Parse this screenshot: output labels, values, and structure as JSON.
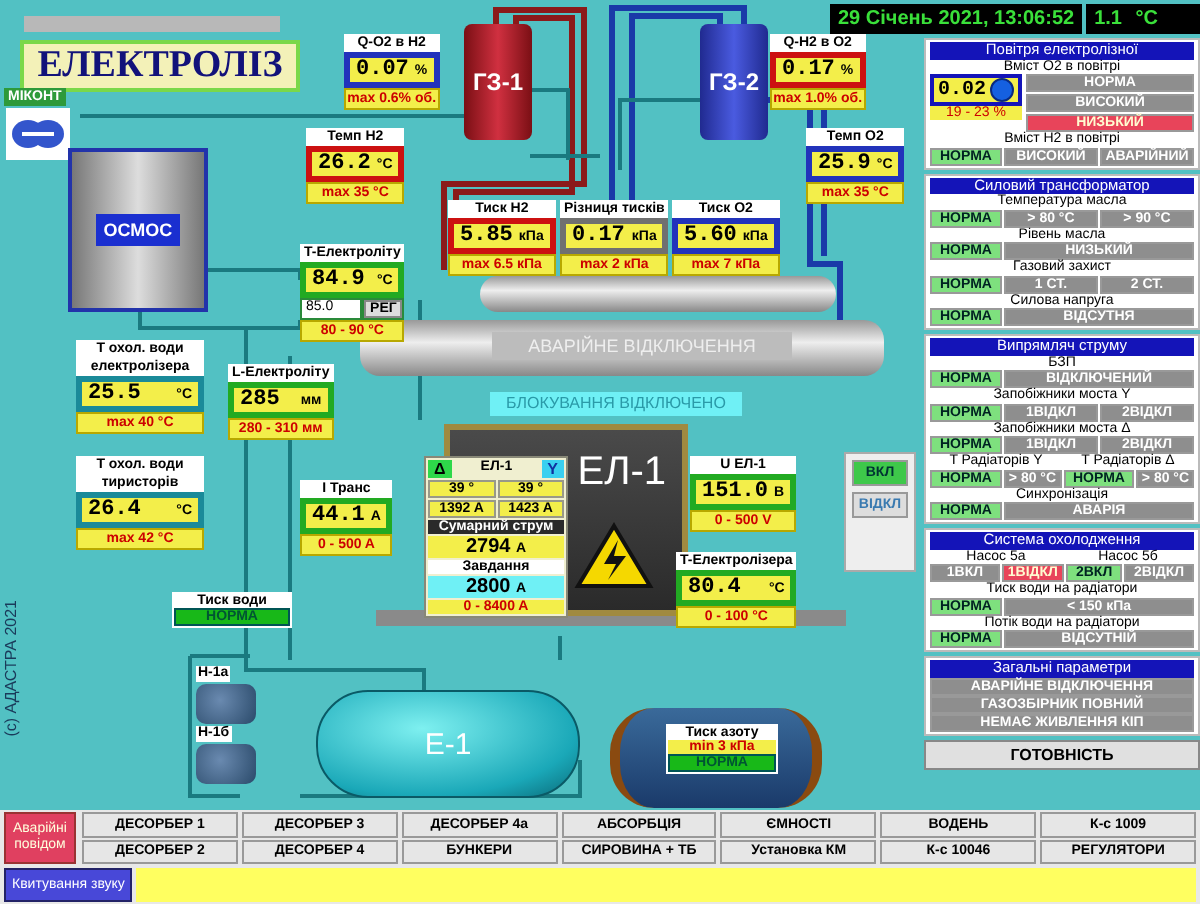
{
  "header": {
    "title": "ЕЛЕКТРОЛІЗ",
    "datetime": "29 Січень 2021, 13:06:52",
    "outdoor_temp": "1.1",
    "outdoor_unit": "°C"
  },
  "controller": {
    "label": "МІКОНТ"
  },
  "equipment": [
    {
      "kind": "h2-separator",
      "label": "ГЗ-1"
    },
    {
      "kind": "o2-separator",
      "label": "ГЗ-2"
    },
    {
      "kind": "osmosis",
      "label": "ОСМОС"
    },
    {
      "kind": "tank",
      "label": "Е-1"
    },
    {
      "kind": "pump-a",
      "label": "Н-1а"
    },
    {
      "kind": "pump-b",
      "label": "Н-1б"
    }
  ],
  "gauges": [
    {
      "title": "Q-O2 в H2",
      "value": "0.07",
      "unit": "%",
      "limit": "max 0.6% об.",
      "color": "#2233bb"
    },
    {
      "title": "Q-H2 в O2",
      "value": "0.17",
      "unit": "%",
      "limit": "max 1.0% об.",
      "color": "#cc1111"
    },
    {
      "title": "Темп H2",
      "value": "26.2",
      "unit": "°C",
      "limit": "max 35 °C",
      "color": "#cc1111"
    },
    {
      "title": "Темп O2",
      "value": "25.9",
      "unit": "°C",
      "limit": "max 35 °C",
      "color": "#2233bb"
    },
    {
      "title": "Тиск H2",
      "value": "5.85",
      "unit": "кПа",
      "limit": "max 6.5 кПа",
      "color": "#cc1111"
    },
    {
      "title": "Різниця тисків",
      "value": "0.17",
      "unit": "кПа",
      "limit": "max 2 кПа",
      "color": "#707070"
    },
    {
      "title": "Тиск O2",
      "value": "5.60",
      "unit": "кПа",
      "limit": "max 7 кПа",
      "color": "#2233bb"
    },
    {
      "title": "T-Електроліту",
      "value": "84.9",
      "unit": "°C",
      "limit": "80 - 90 °C",
      "color": "#22aa22",
      "setpoint": "85.0",
      "mode": "РЕГ"
    },
    {
      "title": "Т охол. води електролізера",
      "value": "25.5",
      "unit": "°C",
      "limit": "max 40 °C",
      "color": "#1a8a99"
    },
    {
      "title": "Т охол. води тиристорів",
      "value": "26.4",
      "unit": "°C",
      "limit": "max 42 °C",
      "color": "#1a8a99"
    },
    {
      "title": "L-Електроліту",
      "value": "285",
      "unit": "мм",
      "limit": "280 - 310 мм",
      "color": "#22aa22"
    },
    {
      "title": "I Транс",
      "value": "44.1",
      "unit": "A",
      "limit": "0 - 500 A",
      "color": "#22aa22"
    },
    {
      "title": "U ЕЛ-1",
      "value": "151.0",
      "unit": "В",
      "limit": "0 - 500 V",
      "color": "#22aa22"
    },
    {
      "title": "T-Електролізера",
      "value": "80.4",
      "unit": "°C",
      "limit": "0 - 100 °C",
      "color": "#22aa22"
    }
  ],
  "electrolyzer": {
    "label": "ЕЛ-1",
    "bridge_delta": "Δ",
    "name": "ЕЛ-1",
    "bridge_y": "Y",
    "temps": [
      {
        "value": "39",
        "unit": "°"
      },
      {
        "value": "39",
        "unit": "°"
      }
    ],
    "currents": [
      {
        "value": "1392",
        "unit": "A"
      },
      {
        "value": "1423",
        "unit": "A"
      }
    ],
    "total_title": "Сумарний струм",
    "total": "2794",
    "total_unit": "A",
    "setpoint_title": "Завдання",
    "setpoint": "2800",
    "setpoint_unit": "A",
    "range": "0 - 8400 A"
  },
  "emergency_banner": {
    "text": "АВАРІЙНЕ ВІДКЛЮЧЕННЯ",
    "active": false
  },
  "blocking_banner": {
    "text": "БЛОКУВАННЯ ВІДКЛЮЧЕНО",
    "active": true
  },
  "power_buttons": [
    {
      "label": "ВКЛ",
      "selected": true
    },
    {
      "label": "ВІДКЛ",
      "selected": false
    }
  ],
  "water_pressure": {
    "title": "Тиск води",
    "status": "НОРМА"
  },
  "nitrogen": {
    "title": "Тиск азоту",
    "limit": "min 3 кПа",
    "status": "НОРМА"
  },
  "copyright": "(c) АДАСТРА 2021",
  "panels": [
    {
      "title": "Повітря електролізної",
      "rows": [
        {
          "kind": "label",
          "texts": [
            "Вміст О2 в повітрі"
          ]
        },
        {
          "kind": "reading",
          "value": "0.02",
          "range": "19 - 23 %",
          "cells": [
            {
              "text": "НОРМА",
              "kind": "off"
            },
            {
              "text": "ВИСОКИЙ",
              "kind": "off"
            },
            {
              "text": "НИЗЬКИЙ",
              "kind": "alarm"
            }
          ]
        },
        {
          "kind": "label",
          "texts": [
            "Вміст H2 в повітрі"
          ]
        },
        {
          "kind": "status",
          "cells": [
            {
              "text": "НОРМА",
              "kind": "norm"
            },
            {
              "text": "ВИСОКИЙ",
              "kind": "off"
            },
            {
              "text": "АВАРІЙНИЙ",
              "kind": "off"
            }
          ]
        }
      ]
    },
    {
      "title": "Силовий трансформатор",
      "rows": [
        {
          "kind": "label",
          "texts": [
            "Температура масла"
          ]
        },
        {
          "kind": "status",
          "cells": [
            {
              "text": "НОРМА",
              "kind": "norm"
            },
            {
              "text": "> 80 °C",
              "kind": "off"
            },
            {
              "text": "> 90 °C",
              "kind": "off"
            }
          ]
        },
        {
          "kind": "label",
          "texts": [
            "Рівень масла"
          ]
        },
        {
          "kind": "status",
          "cells": [
            {
              "text": "НОРМА",
              "kind": "norm"
            },
            {
              "text": "НИЗЬКИЙ",
              "kind": "off"
            }
          ]
        },
        {
          "kind": "label",
          "texts": [
            "Газовий захист"
          ]
        },
        {
          "kind": "status",
          "cells": [
            {
              "text": "НОРМА",
              "kind": "norm"
            },
            {
              "text": "1 СТ.",
              "kind": "off"
            },
            {
              "text": "2 СТ.",
              "kind": "off"
            }
          ]
        },
        {
          "kind": "label",
          "texts": [
            "Силова напруга"
          ]
        },
        {
          "kind": "status",
          "cells": [
            {
              "text": "НОРМА",
              "kind": "norm"
            },
            {
              "text": "ВІДСУТНЯ",
              "kind": "off"
            }
          ]
        }
      ]
    },
    {
      "title": "Випрямляч струму",
      "rows": [
        {
          "kind": "label",
          "texts": [
            "БЗП"
          ]
        },
        {
          "kind": "status",
          "cells": [
            {
              "text": "НОРМА",
              "kind": "norm"
            },
            {
              "text": "ВІДКЛЮЧЕНИЙ",
              "kind": "off"
            }
          ]
        },
        {
          "kind": "label",
          "texts": [
            "Запобіжники моста Y"
          ]
        },
        {
          "kind": "status",
          "cells": [
            {
              "text": "НОРМА",
              "kind": "norm"
            },
            {
              "text": "1ВІДКЛ",
              "kind": "off"
            },
            {
              "text": "2ВІДКЛ",
              "kind": "off"
            }
          ]
        },
        {
          "kind": "label",
          "texts": [
            "Запобіжники моста Δ"
          ]
        },
        {
          "kind": "status",
          "cells": [
            {
              "text": "НОРМА",
              "kind": "norm"
            },
            {
              "text": "1ВІДКЛ",
              "kind": "off"
            },
            {
              "text": "2ВІДКЛ",
              "kind": "off"
            }
          ]
        },
        {
          "kind": "label",
          "texts": [
            "T Радіаторів Y",
            "T Радіаторів Δ"
          ]
        },
        {
          "kind": "status",
          "cells": [
            {
              "text": "НОРМА",
              "kind": "norm"
            },
            {
              "text": "> 80 °C",
              "kind": "off"
            },
            {
              "text": "НОРМА",
              "kind": "norm"
            },
            {
              "text": "> 80 °C",
              "kind": "off"
            }
          ]
        },
        {
          "kind": "label",
          "texts": [
            "Синхронізація"
          ]
        },
        {
          "kind": "status",
          "cells": [
            {
              "text": "НОРМА",
              "kind": "norm"
            },
            {
              "text": "АВАРІЯ",
              "kind": "off"
            }
          ]
        }
      ]
    },
    {
      "title": "Система охолодження",
      "rows": [
        {
          "kind": "label",
          "texts": [
            "Насос 5а",
            "Насос 5б"
          ]
        },
        {
          "kind": "status",
          "cells": [
            {
              "text": "1ВКЛ",
              "kind": "off"
            },
            {
              "text": "1ВІДКЛ",
              "kind": "alarm"
            },
            {
              "text": "2ВКЛ",
              "kind": "norm"
            },
            {
              "text": "2ВІДКЛ",
              "kind": "off"
            }
          ]
        },
        {
          "kind": "label",
          "texts": [
            "Тиск води на радіатори"
          ]
        },
        {
          "kind": "status",
          "cells": [
            {
              "text": "НОРМА",
              "kind": "norm"
            },
            {
              "text": "< 150 кПа",
              "kind": "off"
            }
          ]
        },
        {
          "kind": "label",
          "texts": [
            "Потік води на радіатори"
          ]
        },
        {
          "kind": "status",
          "cells": [
            {
              "text": "НОРМА",
              "kind": "norm"
            },
            {
              "text": "ВІДСУТНІЙ",
              "kind": "off"
            }
          ]
        }
      ]
    },
    {
      "title": "Загальні параметри",
      "rows": [
        {
          "kind": "status",
          "cells": [
            {
              "text": "АВАРІЙНЕ ВІДКЛЮЧЕННЯ",
              "kind": "off"
            }
          ]
        },
        {
          "kind": "status",
          "cells": [
            {
              "text": "ГАЗОЗБІРНИК ПОВНИЙ",
              "kind": "off"
            }
          ]
        },
        {
          "kind": "status",
          "cells": [
            {
              "text": "НЕМАЄ ЖИВЛЕННЯ КІП",
              "kind": "off"
            }
          ]
        }
      ]
    }
  ],
  "ready_button": "ГОТОВНІСТЬ",
  "alarm_button": "Аварійні повідом",
  "nav_buttons": [
    "ДЕСОРБЕР 1",
    "ДЕСОРБЕР 3",
    "ДЕСОРБЕР 4а",
    "АБСОРБЦІЯ",
    "ЄМНОСТІ",
    "ВОДЕНЬ",
    "К-с 1009",
    "ДЕСОРБЕР 2",
    "ДЕСОРБЕР 4",
    "БУНКЕРИ",
    "СИРОВИНА + ТБ",
    "Установка КМ",
    "К-с 10046",
    "РЕГУЛЯТОРИ"
  ],
  "sound_ack": "Квитування звуку"
}
